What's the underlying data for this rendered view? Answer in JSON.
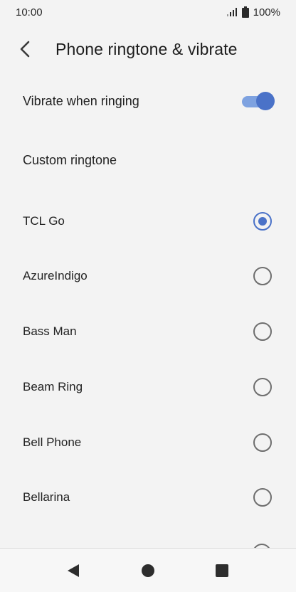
{
  "status_bar": {
    "time": "10:00",
    "battery": "100%",
    "signal_icon": "signal-icon",
    "battery_icon": "battery-icon"
  },
  "header": {
    "back_icon": "back-arrow-icon",
    "title": "Phone ringtone & vibrate"
  },
  "settings": {
    "vibrate_label": "Vibrate when ringing",
    "vibrate_on": true,
    "custom_ringtone_label": "Custom ringtone"
  },
  "ringtones": [
    {
      "label": "TCL Go",
      "selected": true
    },
    {
      "label": "AzureIndigo",
      "selected": false
    },
    {
      "label": "Bass Man",
      "selected": false
    },
    {
      "label": "Beam Ring",
      "selected": false
    },
    {
      "label": "Bell Phone",
      "selected": false
    },
    {
      "label": "Bellarina",
      "selected": false
    }
  ],
  "nav_bar": {
    "back_icon": "nav-back-icon",
    "home_icon": "nav-home-icon",
    "recents_icon": "nav-recents-icon"
  },
  "colors": {
    "accent": "#4a72c8",
    "accent_light": "#7ea2e0",
    "background": "#f3f3f3"
  }
}
